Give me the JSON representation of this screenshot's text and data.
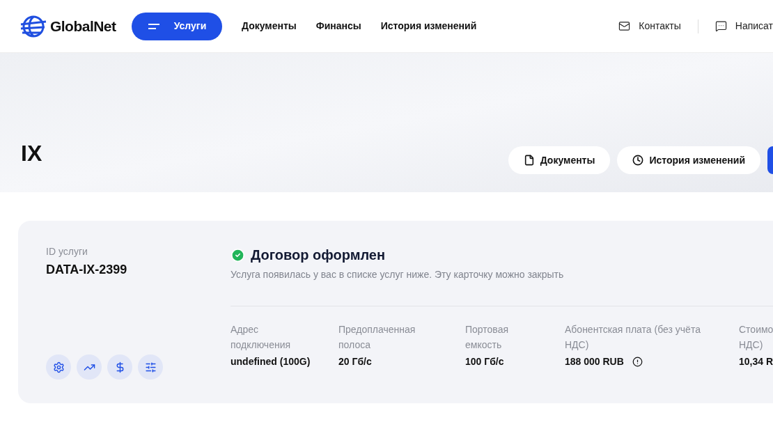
{
  "header": {
    "logo": "GlobalNet",
    "nav": [
      {
        "label": "Услуги",
        "selected": true
      },
      {
        "label": "Документы",
        "selected": false
      },
      {
        "label": "Финансы",
        "selected": false
      },
      {
        "label": "История изменений",
        "selected": false
      }
    ],
    "contacts": "Контакты",
    "write": "Написат"
  },
  "hero": {
    "title": "IX",
    "buttons": [
      {
        "kind": "document",
        "label": "Документы"
      },
      {
        "kind": "history",
        "label": "История изменений"
      }
    ]
  },
  "card": {
    "id_label": "ID услуги",
    "id_value": "DATA-IX-2399",
    "status": {
      "done": true,
      "title": "Договор оформлен",
      "text": "Услуга появилась у вас в списке услуг ниже. Эту карточку можно закрыть"
    },
    "actions": [
      {
        "kind": "settings"
      },
      {
        "kind": "chart"
      },
      {
        "kind": "dollar"
      },
      {
        "kind": "sliders"
      }
    ],
    "fields": [
      {
        "label": "Адрес подключения",
        "value": "undefined (100G)",
        "info": false
      },
      {
        "label": "Предоплаченная полоса",
        "value": "20 Гб/с",
        "info": false
      },
      {
        "label": "Портовая емкость",
        "value": "100 Гб/с",
        "info": false
      },
      {
        "label": "Абонентская плата (без учёта НДС)",
        "value": "188 000 RUB",
        "info": true
      },
      {
        "label": "Стоимо НДС)",
        "value": "10,34 R",
        "info": false
      }
    ]
  }
}
